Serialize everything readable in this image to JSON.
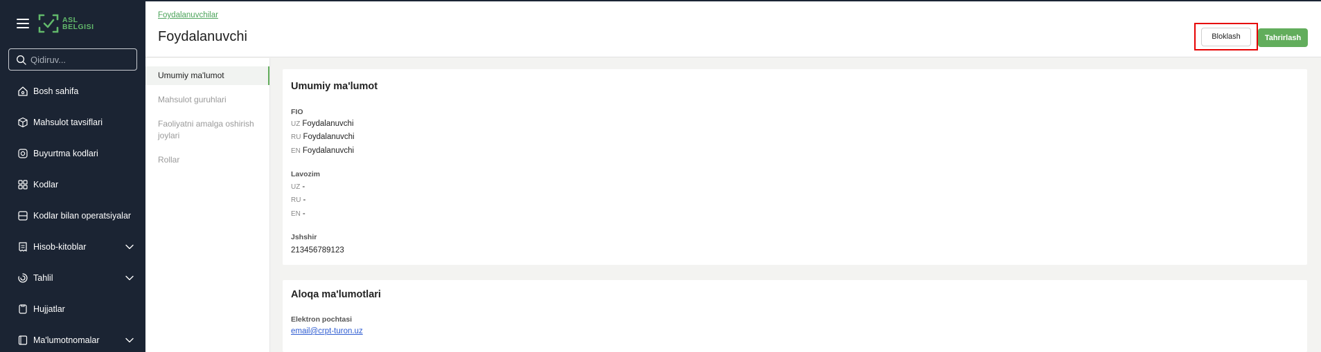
{
  "sidebar": {
    "logo_line1": "ASL",
    "logo_line2": "BELGISI",
    "search_placeholder": "Qidiruv...",
    "items": [
      {
        "label": "Bosh sahifa",
        "icon": "home-icon"
      },
      {
        "label": "Mahsulot tavsiflari",
        "icon": "box-icon"
      },
      {
        "label": "Buyurtma kodlari",
        "icon": "order-codes-icon"
      },
      {
        "label": "Kodlar",
        "icon": "codes-icon"
      },
      {
        "label": "Kodlar bilan operatsiyalar",
        "icon": "operations-icon"
      },
      {
        "label": "Hisob-kitoblar",
        "icon": "receipt-icon",
        "expandable": true
      },
      {
        "label": "Tahlil",
        "icon": "analytics-icon",
        "expandable": true
      },
      {
        "label": "Hujjatlar",
        "icon": "document-icon"
      },
      {
        "label": "Ma'lumotnomalar",
        "icon": "book-icon",
        "expandable": true
      }
    ]
  },
  "header": {
    "breadcrumb": "Foydalanuvchilar",
    "title": "Foydalanuvchi",
    "block_label": "Bloklash",
    "edit_label": "Tahrirlash"
  },
  "tabs": [
    {
      "label": "Umumiy ma'lumot",
      "active": true
    },
    {
      "label": "Mahsulot guruhlari",
      "active": false
    },
    {
      "label": "Faoliyatni amalga oshirish joylari",
      "active": false
    },
    {
      "label": "Rollar",
      "active": false
    }
  ],
  "general": {
    "title": "Umumiy ma'lumot",
    "fio_label": "FIO",
    "fio": [
      {
        "lang": "UZ",
        "value": "Foydalanuvchi"
      },
      {
        "lang": "RU",
        "value": "Foydalanuvchi"
      },
      {
        "lang": "EN",
        "value": "Foydalanuvchi"
      }
    ],
    "position_label": "Lavozim",
    "position": [
      {
        "lang": "UZ",
        "value": "-"
      },
      {
        "lang": "RU",
        "value": "-"
      },
      {
        "lang": "EN",
        "value": "-"
      }
    ],
    "pinfl_label": "Jshshir",
    "pinfl": "213456789123"
  },
  "contacts": {
    "title": "Aloqa ma'lumotlari",
    "email_label": "Elektron pochtasi",
    "email": "email@crpt-turon.uz"
  },
  "colors": {
    "sidebar_bg": "#1b2433",
    "accent_green": "#62ad5c",
    "highlight_red": "#e60000"
  }
}
